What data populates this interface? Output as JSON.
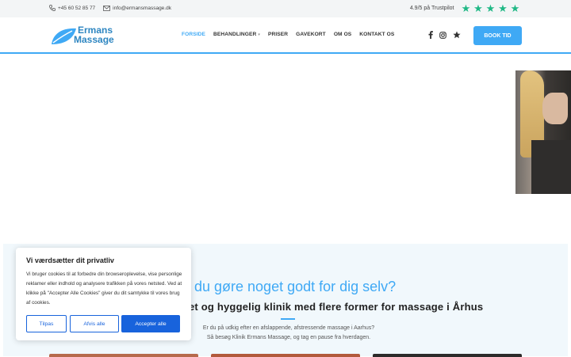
{
  "topbar": {
    "phone": "+45 60 52 85 77",
    "email": "info@ermansmassage.dk",
    "rating_text": "4.9/5 på Trustpilot",
    "star_count": 5,
    "star_color": "#1fb885"
  },
  "logo": {
    "line1": "Ermans",
    "line2": "Massage",
    "color": "#2e86c1"
  },
  "nav": {
    "items": [
      {
        "label": "FORSIDE",
        "active": true
      },
      {
        "label": "BEHANDLINGER",
        "caret": true
      },
      {
        "label": "PRISER"
      },
      {
        "label": "GAVEKORT"
      },
      {
        "label": "OM OS"
      },
      {
        "label": "KONTAKT OS"
      }
    ]
  },
  "social": {
    "icons": [
      "facebook-icon",
      "instagram-icon",
      "star-icon"
    ]
  },
  "header": {
    "book_label": "BOOK TID",
    "accent_color": "#3fa9f5"
  },
  "section": {
    "heading": "il du gøre noget godt for dig selv?",
    "subheading": "et og hyggelig klinik med flere former for massage i Århus",
    "paragraph_line1": "Er du på udkig efter en afslappende, afstressende massage i Aarhus?",
    "paragraph_line2": "Så besøg Klinik Ermans Massage, og tag en pause fra hverdagen."
  },
  "cookie": {
    "title": "Vi værdsætter dit privatliv",
    "text": "Vi bruger cookies til at forbedre din browseroplevelse, vise personlige reklamer eller indhold og analysere trafikken på vores netsted. Ved at klikke på \"Accepter Alle Cookies\" giver du dit samtykke til vores brug af cookies.",
    "customize_label": "Tilpas",
    "reject_label": "Afvis alle",
    "accept_label": "Accepter alle",
    "button_color": "#1863dc"
  }
}
